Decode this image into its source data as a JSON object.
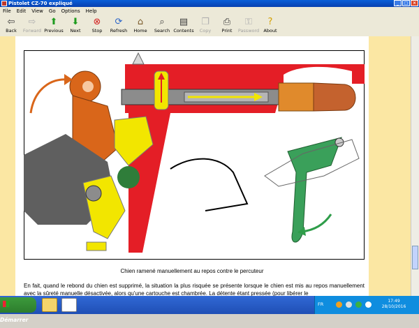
{
  "window": {
    "title": "Pistolet CZ-70 expliqué"
  },
  "menu": [
    "File",
    "Edit",
    "View",
    "Go",
    "Options",
    "Help"
  ],
  "toolbar": {
    "back": "Back",
    "forward": "Forward",
    "previous": "Previous",
    "next": "Next",
    "stop": "Stop",
    "refresh": "Refresh",
    "home": "Home",
    "search": "Search",
    "contents": "Contents",
    "copy": "Copy",
    "print": "Print",
    "password": "Password",
    "about": "About"
  },
  "page": {
    "caption": "Chien ramené manuellement au repos contre le percuteur",
    "paragraph": "En fait, quand le rebond du chien est supprimé, la situation la plus risquée se présente lorsque le chien est mis au repos manuellement avec la sûreté manuelle désactivée, alors qu'une cartouche est chambrée. La détente étant pressée (pour libérer le"
  },
  "taskbar": {
    "start": "Démarrer",
    "language": "FR",
    "time": "17:49",
    "date": "28/10/2016"
  },
  "colors": {
    "red": "#e41e26",
    "orange": "#d9661a",
    "yellow": "#f2e600",
    "green": "#2f9d4a",
    "gray": "#5f5f5f",
    "page_margin": "#fbe7a3"
  }
}
